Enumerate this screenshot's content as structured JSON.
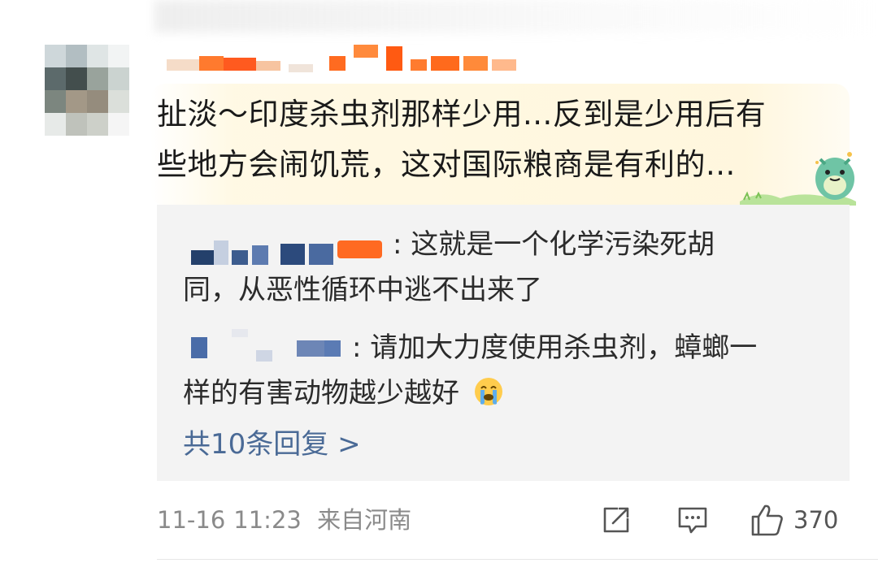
{
  "comment": {
    "text_line1": "扯淡～印度杀虫剂那样少用...反到是少用后有",
    "text_line2": "些地方会闹饥荒，这对国际粮商是有利的..."
  },
  "replies": [
    {
      "separator": ":",
      "text_line1": "这就是一个化学污染死胡",
      "text_line2": "同，从恶性循环中逃不出来了"
    },
    {
      "separator": ":",
      "text_line1": "请加大力度使用杀虫剂，蟑螂一",
      "text_line2": "样的有害动物越少越好"
    }
  ],
  "more_replies_label": "共10条回复 >",
  "meta": {
    "date": "11-16",
    "time": "11:23",
    "location": "来自河南"
  },
  "actions": {
    "share_icon": "share-icon",
    "comment_icon": "comment-icon",
    "like_icon": "thumbs-up-icon",
    "like_count": "370"
  },
  "colors": {
    "link": "#4a6a96",
    "highlight": "#fff6dc",
    "reply_bg": "#f3f3f3"
  }
}
